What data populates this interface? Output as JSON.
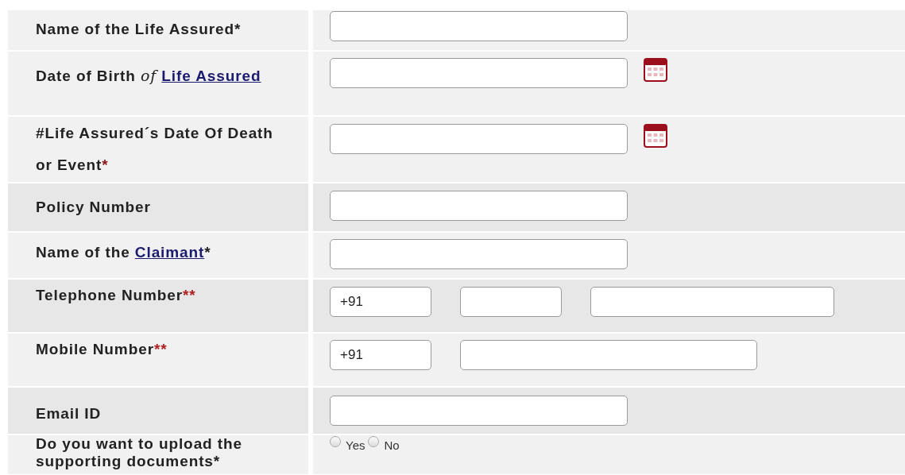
{
  "form": {
    "rows": [
      {
        "label": [
          {
            "kind": "text",
            "text": "Name of the Life Assured"
          },
          {
            "kind": "required",
            "text": "*",
            "color": "#222222"
          }
        ],
        "field": {
          "kind": "text"
        }
      },
      {
        "label": [
          {
            "kind": "text",
            "text": "Date of Birth"
          },
          {
            "kind": "italic",
            "text": "of"
          },
          {
            "kind": "link",
            "text": "Life Assured"
          }
        ],
        "field": {
          "kind": "date"
        }
      },
      {
        "label": [
          {
            "kind": "text",
            "text": "#Life Assured´s Date Of Death or Event"
          },
          {
            "kind": "required",
            "text": "*",
            "color": "#8b1a1a"
          }
        ],
        "field": {
          "kind": "date"
        }
      },
      {
        "label": [
          {
            "kind": "text",
            "text": "Policy Number"
          }
        ],
        "field": {
          "kind": "text"
        }
      },
      {
        "label": [
          {
            "kind": "text",
            "text": "Name of the"
          },
          {
            "kind": "link",
            "text": "Claimant"
          },
          {
            "kind": "required",
            "text": "*",
            "color": "#222222"
          }
        ],
        "field": {
          "kind": "text"
        }
      },
      {
        "label": [
          {
            "kind": "text",
            "text": "Telephone Number"
          },
          {
            "kind": "required",
            "text": "**",
            "color": "#b22222"
          }
        ],
        "field": {
          "kind": "phone",
          "parts": [
            {
              "kind": "code",
              "value": "+91"
            },
            {
              "kind": "area"
            },
            {
              "kind": "number"
            }
          ]
        }
      },
      {
        "label": [
          {
            "kind": "text",
            "text": "Mobile Number"
          },
          {
            "kind": "required",
            "text": "**",
            "color": "#b22222"
          }
        ],
        "field": {
          "kind": "phone",
          "parts": [
            {
              "kind": "code",
              "value": "+91"
            },
            {
              "kind": "mobile"
            }
          ]
        }
      },
      {
        "label": [
          {
            "kind": "text",
            "text": "Email ID"
          }
        ],
        "field": {
          "kind": "text"
        }
      },
      {
        "label": [
          {
            "kind": "text",
            "text": "Do you want to upload the supporting documents"
          },
          {
            "kind": "required",
            "text": "*",
            "color": "#222222"
          }
        ],
        "field": {
          "kind": "radio",
          "options": [
            {
              "label": "Yes",
              "selected": false
            },
            {
              "label": "No",
              "selected": false
            }
          ]
        }
      }
    ]
  }
}
